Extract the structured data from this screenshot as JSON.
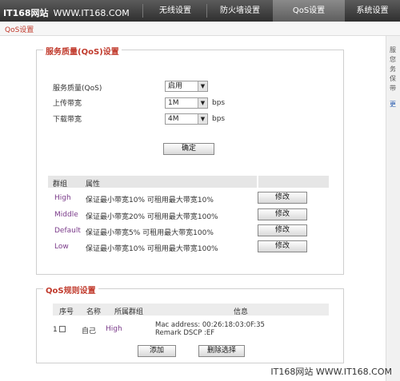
{
  "watermark_top": {
    "brand": "IT168网站",
    "site": "WWW.IT168.COM"
  },
  "nav": {
    "tabs": [
      {
        "label": "无线设置"
      },
      {
        "label": "防火墙设置"
      },
      {
        "label": "QoS设置",
        "active": true
      },
      {
        "label": "系统设置"
      }
    ]
  },
  "subnav": {
    "label": "QoS设置"
  },
  "right_pane": {
    "lines": [
      "服",
      "您",
      "务",
      "保",
      "带"
    ],
    "more": "更"
  },
  "qos_panel": {
    "legend": "服务质量(QoS)设置",
    "fields": {
      "qos_label": "服务质量(QoS)",
      "qos_value": "启用",
      "upload_label": "上传带宽",
      "upload_value": "1M",
      "upload_unit": "bps",
      "download_label": "下载带宽",
      "download_value": "4M",
      "download_unit": "bps"
    },
    "confirm_label": "确定",
    "table": {
      "headers": {
        "group": "群组",
        "property": "属性"
      },
      "rows": [
        {
          "group": "High",
          "property": "保证最小带宽10% 可租用最大带宽10%",
          "action": "修改"
        },
        {
          "group": "Middle",
          "property": "保证最小带宽20% 可租用最大带宽100%",
          "action": "修改"
        },
        {
          "group": "Default",
          "property": "保证最小带宽5% 可租用最大带宽100%",
          "action": "修改"
        },
        {
          "group": "Low",
          "property": "保证最小带宽10% 可租用最大带宽100%",
          "action": "修改"
        }
      ]
    }
  },
  "rules_panel": {
    "legend": "QoS规则设置",
    "headers": {
      "index": "序号",
      "name": "名称",
      "group": "所属群组",
      "info": "信息"
    },
    "rows": [
      {
        "index": "1",
        "name": "自己",
        "group": "High",
        "info_line1": "Mac address: 00:26:18:03:0F:35",
        "info_line2": "Remark DSCP :EF"
      }
    ],
    "add_label": "添加",
    "delete_label": "删除选择"
  },
  "watermark_bottom": "IT168网站 WWW.IT168.COM"
}
